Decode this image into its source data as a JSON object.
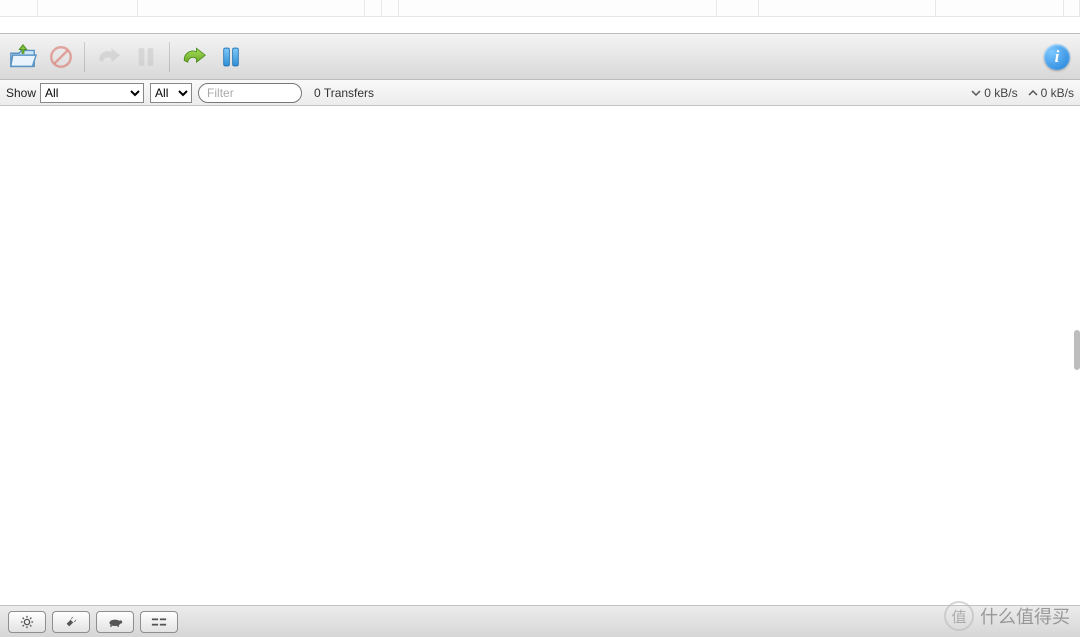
{
  "top_tabs_widths": [
    38,
    100,
    227,
    17,
    17,
    318,
    42,
    177,
    128,
    16
  ],
  "toolbar": {
    "icons": {
      "open": "open-folder-icon",
      "remove": "remove-circle-icon",
      "resume_one": "resume-arrow-icon",
      "pause_one": "pause-icon",
      "resume_all": "resume-all-arrow-icon",
      "pause_all": "pause-all-icon",
      "info": "info-icon"
    }
  },
  "filterbar": {
    "show_label": "Show",
    "dropdown1_selected": "All",
    "dropdown2_selected": "All",
    "filter_placeholder": "Filter",
    "transfers_text": "0 Transfers",
    "down_rate": "0 kB/s",
    "up_rate": "0 kB/s"
  },
  "bottombar": {
    "buttons": [
      "gear-icon",
      "wrench-icon",
      "turtle-icon",
      "ratio-icon"
    ]
  },
  "watermark": {
    "badge": "值",
    "text": "什么值得买"
  },
  "colors": {
    "green": "#86c13f",
    "blue": "#3ea2e5",
    "grey": "#c7c7c7",
    "red": "#d96b5f"
  }
}
